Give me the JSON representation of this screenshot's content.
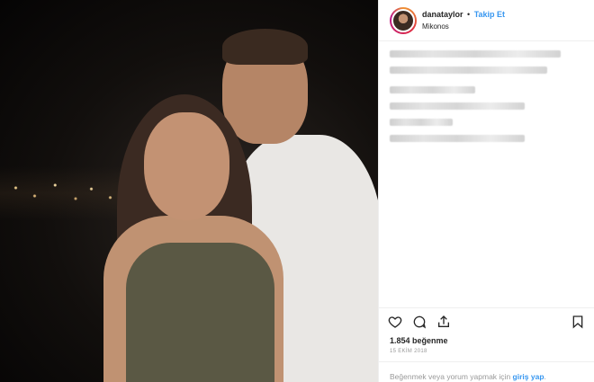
{
  "header": {
    "username": "danataylor",
    "separator": "•",
    "follow_label": "Takip Et",
    "location": "Mikonos"
  },
  "actions": {
    "icons": [
      "heart-icon",
      "comment-icon",
      "share-icon",
      "bookmark-icon"
    ]
  },
  "likes": {
    "text": "1.854 beğenme"
  },
  "date": {
    "text": "15 EKİM 2018"
  },
  "login_prompt": {
    "prefix": "Beğenmek veya yorum yapmak için",
    "link": "giriş yap",
    "suffix": "."
  },
  "colors": {
    "accent": "#3897f0",
    "text": "#262626",
    "muted": "#999999",
    "divider": "#efefef"
  }
}
